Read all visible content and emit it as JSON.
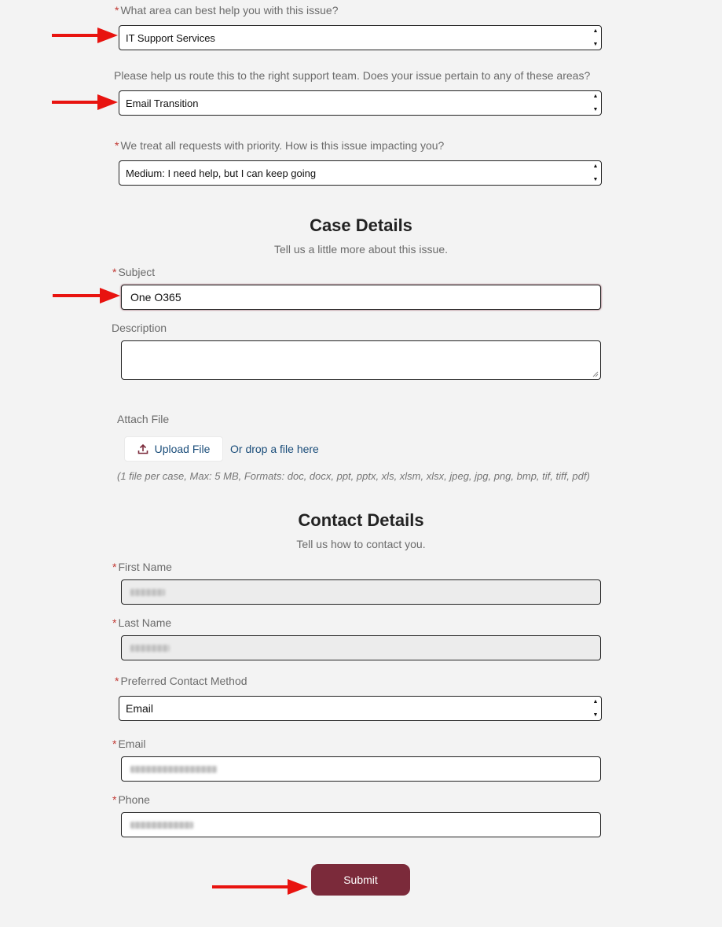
{
  "area": {
    "required_mark": "*",
    "label": "What area can best help you with this issue?",
    "value": "IT Support Services"
  },
  "route": {
    "label": "Please help us route this to the right support team. Does your issue pertain to any of these areas?",
    "value": "Email Transition"
  },
  "priority": {
    "required_mark": "*",
    "label": "We treat all requests with priority. How is this issue impacting you?",
    "value": "Medium: I need help, but I can keep going"
  },
  "case_details": {
    "heading": "Case Details",
    "subheading": "Tell us a little more about this issue.",
    "subject": {
      "required_mark": "*",
      "label": "Subject",
      "value": "One O365"
    },
    "description": {
      "label": "Description",
      "value": ""
    }
  },
  "attach": {
    "label": "Attach File",
    "upload_label": "Upload File",
    "upload_icon": "upload-icon",
    "drop_text": "Or drop a file here",
    "hint": "(1 file per case, Max: 5 MB, Formats: doc, docx, ppt, pptx, xls, xlsm, xlsx, jpeg, jpg, png, bmp, tif, tiff, pdf)"
  },
  "contact_details": {
    "heading": "Contact Details",
    "subheading": "Tell us how to contact you.",
    "first_name": {
      "required_mark": "*",
      "label": "First Name"
    },
    "last_name": {
      "required_mark": "*",
      "label": "Last Name"
    },
    "contact_method": {
      "required_mark": "*",
      "label": "Preferred Contact Method",
      "value": "Email"
    },
    "email": {
      "required_mark": "*",
      "label": "Email"
    },
    "phone": {
      "required_mark": "*",
      "label": "Phone"
    }
  },
  "submit_label": "Submit",
  "colors": {
    "background": "#f3f3f3",
    "submit_button": "#7b2a3a",
    "required_mark": "#c23934",
    "annotation_arrow": "#e8130f",
    "link": "#1a4d7a"
  }
}
